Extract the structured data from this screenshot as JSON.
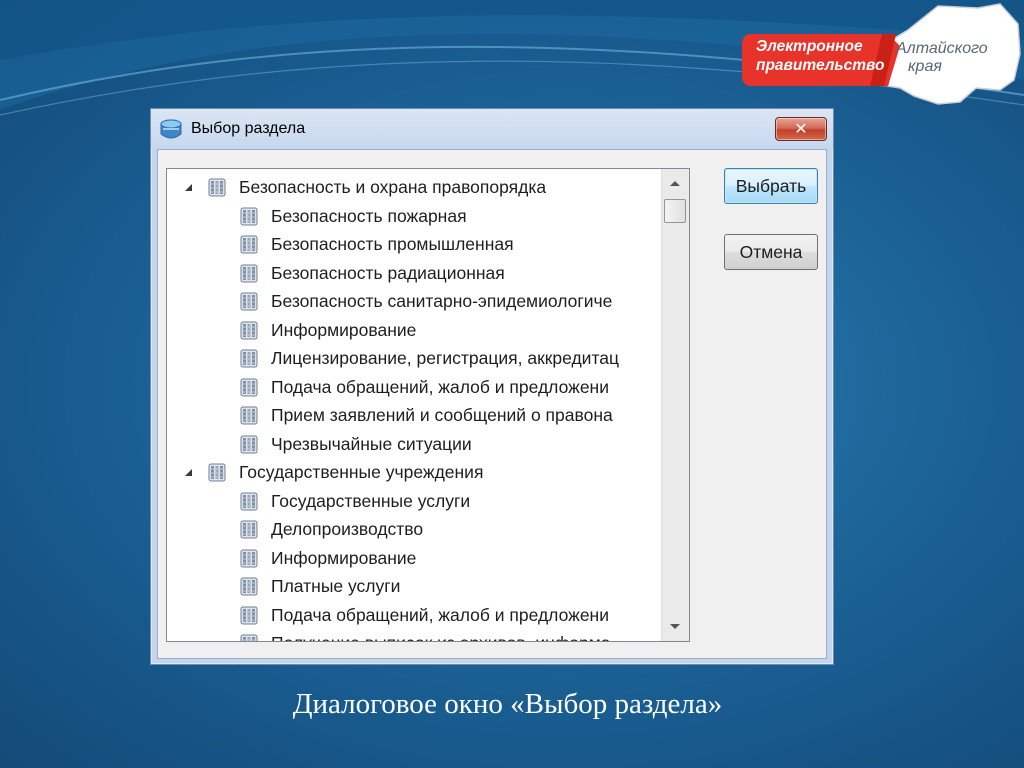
{
  "logo": {
    "red_line1": "Электронное",
    "red_line2": "правительство",
    "white_line1": "Алтайского",
    "white_line2": "края",
    "red_color": "#e8332a"
  },
  "dialog": {
    "title": "Выбор раздела",
    "close_glyph": "✕",
    "buttons": {
      "select": "Выбрать",
      "cancel": "Отмена"
    },
    "tree": [
      {
        "label": "Безопасность и охрана правопорядка",
        "level": 0,
        "expanded": true
      },
      {
        "label": "Безопасность пожарная",
        "level": 1
      },
      {
        "label": "Безопасность промышленная",
        "level": 1
      },
      {
        "label": "Безопасность радиационная",
        "level": 1
      },
      {
        "label": "Безопасность санитарно-эпидемиологиче",
        "level": 1
      },
      {
        "label": "Информирование",
        "level": 1
      },
      {
        "label": "Лицензирование, регистрация, аккредитац",
        "level": 1
      },
      {
        "label": "Подача обращений, жалоб и предложени",
        "level": 1
      },
      {
        "label": "Прием заявлений и сообщений о правона",
        "level": 1
      },
      {
        "label": "Чрезвычайные ситуации",
        "level": 1
      },
      {
        "label": "Государственные учреждения",
        "level": 0,
        "expanded": true
      },
      {
        "label": "Государственные услуги",
        "level": 1
      },
      {
        "label": "Делопроизводство",
        "level": 1
      },
      {
        "label": "Информирование",
        "level": 1
      },
      {
        "label": "Платные услуги",
        "level": 1
      },
      {
        "label": "Подача обращений, жалоб и предложени",
        "level": 1
      },
      {
        "label": "Получение выписок из архивов, информа",
        "level": 1
      }
    ],
    "node_icon": "database-icon"
  },
  "caption": "Диалоговое окно «Выбор раздела»"
}
